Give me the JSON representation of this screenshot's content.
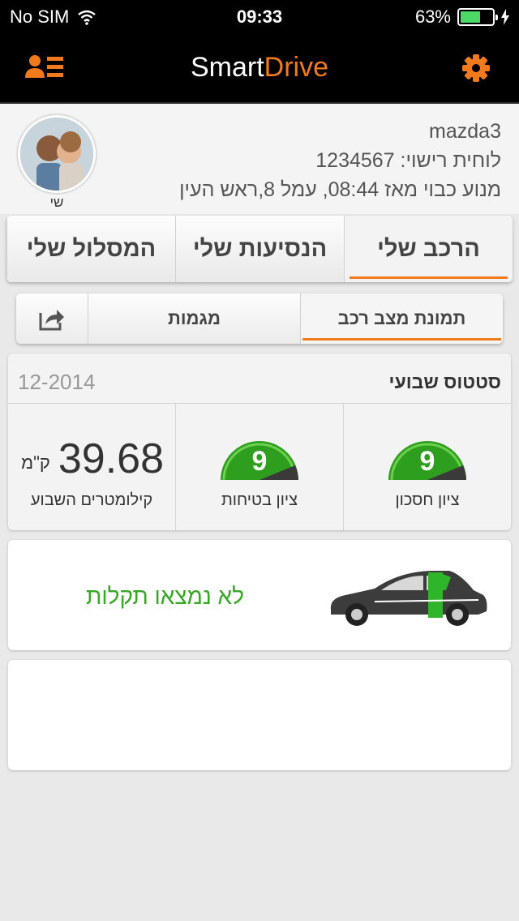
{
  "status_bar": {
    "carrier": "No SIM",
    "time": "09:33",
    "battery": "63%",
    "battery_level": 0.63
  },
  "header": {
    "title_part1": "Smart",
    "title_part2": "Drive",
    "accent_color": "#f07a1c"
  },
  "profile": {
    "name": "שי",
    "car_model": "mazda3",
    "license_plate": "לוחית רישוי: 1234567",
    "engine_status": "מנוע כבוי מאז 08:44, עמל 8,ראש העין"
  },
  "main_tabs": [
    {
      "label": "הרכב שלי"
    },
    {
      "label": "הנסיעות שלי"
    },
    {
      "label": "המסלול שלי"
    }
  ],
  "sub_tabs": [
    {
      "label": "תמונת מצב רכב"
    },
    {
      "label": "מגמות"
    }
  ],
  "weekly": {
    "title": "סטטוס שבועי",
    "date": "12-2014",
    "economy": {
      "score": "9",
      "label": "ציון חסכון"
    },
    "safety": {
      "score": "9",
      "label": "ציון בטיחות"
    },
    "km": {
      "value": "39.68",
      "unit": "ק\"מ",
      "label": "קילומטרים השבוע"
    }
  },
  "car_status": {
    "text": "לא נמצאו תקלות",
    "color": "#36a823"
  }
}
